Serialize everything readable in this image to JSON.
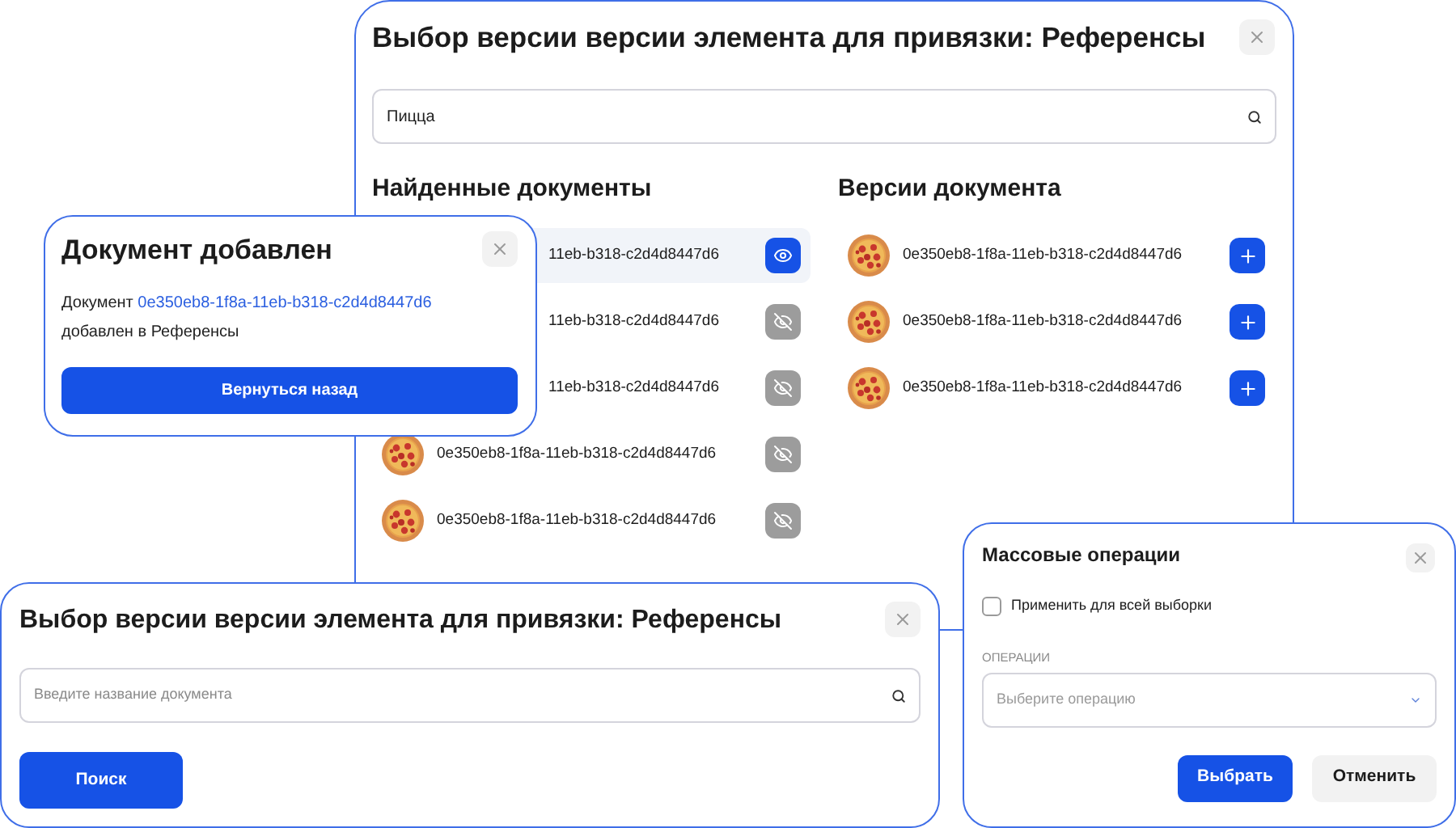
{
  "main_dialog": {
    "title": "Выбор версии версии элемента для привязки: Референсы",
    "search": {
      "value": "Пицца"
    },
    "found_heading": "Найденные документы",
    "found_documents": [
      {
        "kind": "covered",
        "name": "11eb-b318-c2d4d8447d6",
        "selected": true
      },
      {
        "kind": "covered",
        "name": "11eb-b318-c2d4d8447d6",
        "selected": false
      },
      {
        "kind": "covered",
        "name": "11eb-b318-c2d4d8447d6",
        "selected": false
      },
      {
        "kind": "full",
        "name": "0e350eb8-1f8a-11eb-b318-c2d4d8447d6",
        "selected": false
      },
      {
        "kind": "full",
        "name": "0e350eb8-1f8a-11eb-b318-c2d4d8447d6",
        "selected": false
      }
    ],
    "versions_heading": "Версии документа",
    "versions": [
      {
        "name": "0e350eb8-1f8a-11eb-b318-c2d4d8447d6"
      },
      {
        "name": "0e350eb8-1f8a-11eb-b318-c2d4d8447d6"
      },
      {
        "name": "0e350eb8-1f8a-11eb-b318-c2d4d8447d6"
      }
    ]
  },
  "added_dialog": {
    "title": "Документ добавлен",
    "message_before": "Документ",
    "link": "0e350eb8-1f8a-11eb-b318-c2d4d8447d6",
    "message_after": "добавлен в Референсы",
    "button": "Вернуться назад"
  },
  "search_dialog": {
    "title": "Выбор версии версии элемента для привязки: Референсы",
    "search": {
      "placeholder": "Введите название документа"
    },
    "button": "Поиск"
  },
  "bulk_dialog": {
    "title": "Массовые операции",
    "apply_all": {
      "label": "Применить для всей выборки",
      "checked": false
    },
    "operations_label": "ОПЕРАЦИИ",
    "operation_select": {
      "placeholder": "Выберите операцию"
    },
    "buttons": [
      {
        "label": "Выбрать",
        "kind": "primary"
      },
      {
        "label": "Отменить",
        "kind": "secondary"
      }
    ]
  }
}
